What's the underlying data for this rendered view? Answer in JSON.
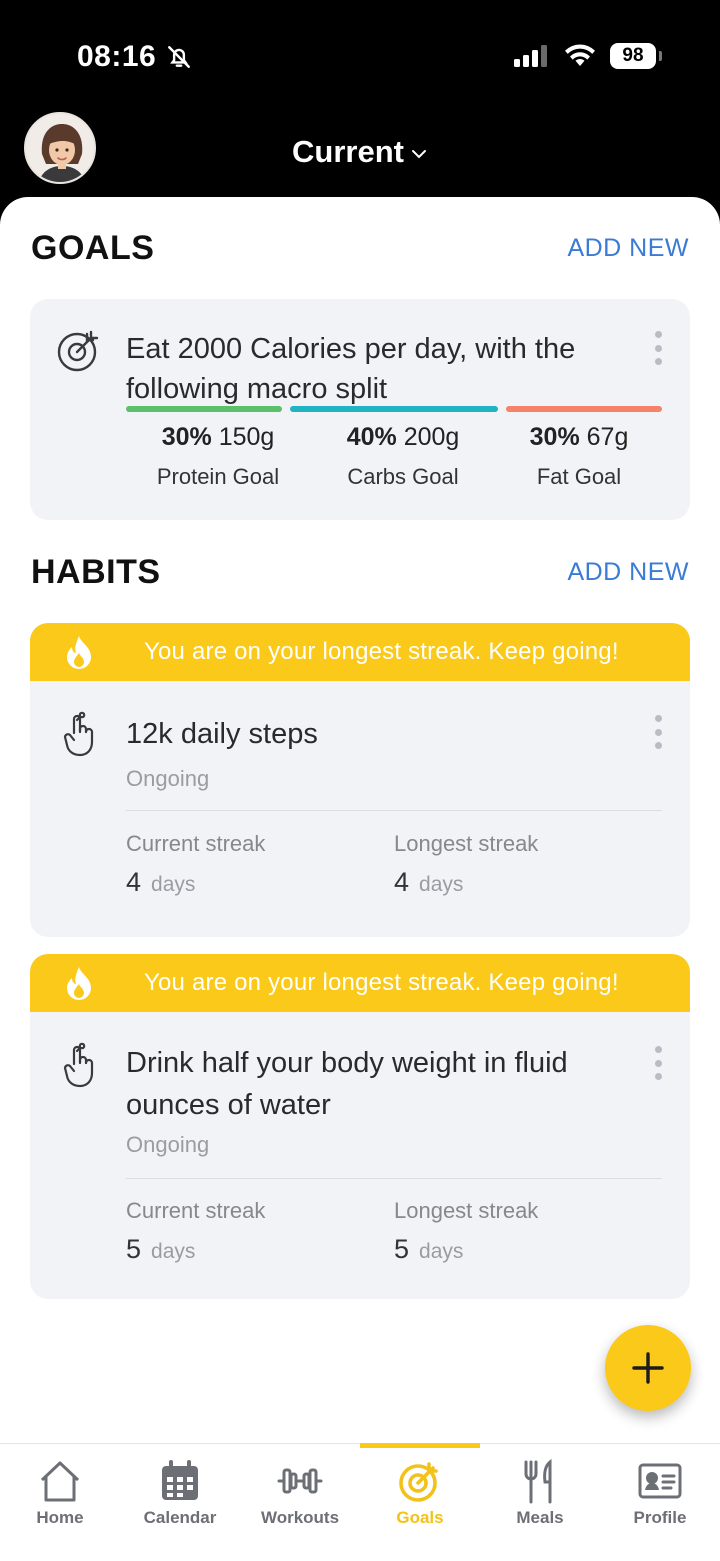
{
  "status_bar": {
    "time": "08:16",
    "battery": "98"
  },
  "header": {
    "title": "Current"
  },
  "goals": {
    "section_title": "GOALS",
    "add_new": "ADD NEW",
    "card": {
      "text": "Eat 2000 Calories per day, with the following macro split",
      "macros": [
        {
          "percent": "30%",
          "grams": "150g",
          "label": "Protein Goal",
          "color": "#5cc06a"
        },
        {
          "percent": "40%",
          "grams": "200g",
          "label": "Carbs Goal",
          "color": "#1fb3c4"
        },
        {
          "percent": "30%",
          "grams": "67g",
          "label": "Fat Goal",
          "color": "#f4836a"
        }
      ]
    }
  },
  "habits": {
    "section_title": "HABITS",
    "add_new": "ADD NEW",
    "items": [
      {
        "banner": "You are on your longest streak. Keep going!",
        "title": "12k daily steps",
        "status": "Ongoing",
        "current_streak_label": "Current streak",
        "current_streak_value": "4",
        "longest_streak_label": "Longest streak",
        "longest_streak_value": "4",
        "unit": "days"
      },
      {
        "banner": "You are on your longest streak. Keep going!",
        "title": "Drink half your body weight in fluid ounces of water",
        "status": "Ongoing",
        "current_streak_label": "Current streak",
        "current_streak_value": "5",
        "longest_streak_label": "Longest streak",
        "longest_streak_value": "5",
        "unit": "days"
      }
    ]
  },
  "tabs": [
    {
      "label": "Home",
      "icon": "home-icon"
    },
    {
      "label": "Calendar",
      "icon": "calendar-icon"
    },
    {
      "label": "Workouts",
      "icon": "dumbbell-icon"
    },
    {
      "label": "Goals",
      "icon": "target-icon",
      "active": true
    },
    {
      "label": "Meals",
      "icon": "fork-knife-icon"
    },
    {
      "label": "Profile",
      "icon": "id-card-icon"
    }
  ],
  "colors": {
    "accent": "#fbc919",
    "link": "#3a7bd5",
    "card": "#f2f3f7"
  }
}
